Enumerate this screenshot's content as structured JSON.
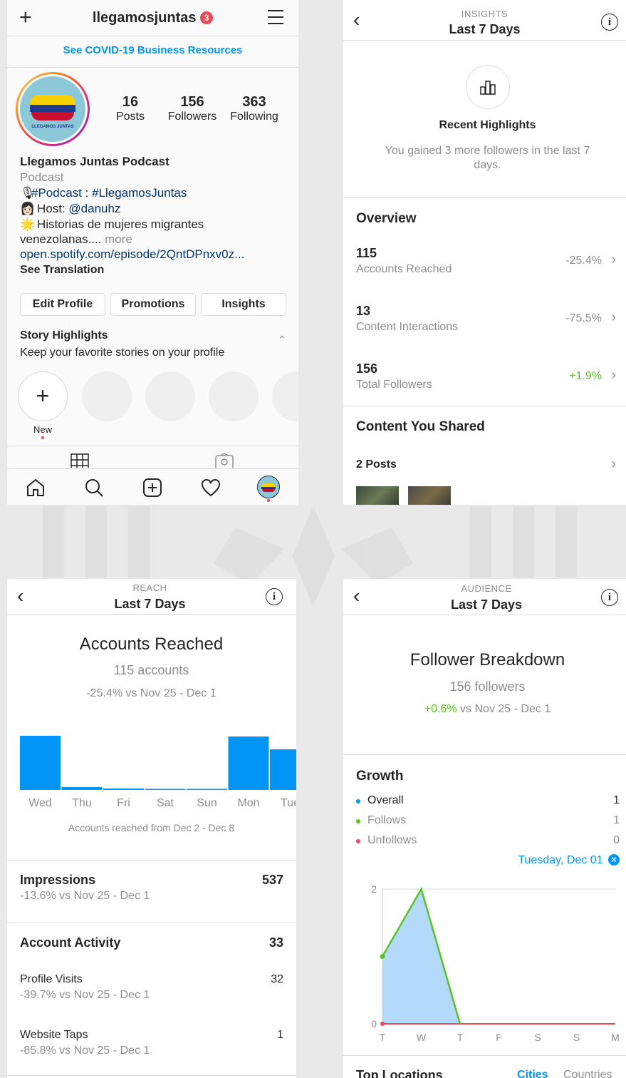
{
  "profile": {
    "username": "llegamosjuntas",
    "notif_count": "3",
    "covid_link": "See COVID-19 Business Resources",
    "avatar_text": "LLEGAMOS JUNTAS",
    "stats": [
      {
        "value": "16",
        "label": "Posts"
      },
      {
        "value": "156",
        "label": "Followers"
      },
      {
        "value": "363",
        "label": "Following"
      }
    ],
    "name": "Llegamos Juntas Podcast",
    "category": "Podcast",
    "bio_line1_tag1": "#Podcast",
    "bio_line1_sep": " : ",
    "bio_line1_tag2": "#LlegamosJuntas",
    "bio_line2_prefix": "Host: ",
    "bio_line2_handle": "@danuhz",
    "bio_line3": "Historias de mujeres migrantes",
    "bio_line4": "venezolanas....",
    "bio_more": " more",
    "bio_url": "open.spotify.com/episode/2QntDPnxv0z...",
    "see_translation": "See Translation",
    "buttons": {
      "edit": "Edit Profile",
      "promotions": "Promotions",
      "insights": "Insights"
    },
    "highlights_title": "Story Highlights",
    "highlights_subtitle": "Keep your favorite stories on your profile",
    "new_label": "New"
  },
  "insights": {
    "header_small": "INSIGHTS",
    "header_title": "Last 7 Days",
    "recent_title": "Recent Highlights",
    "recent_text": "You gained 3 more followers in the last 7 days.",
    "overview_title": "Overview",
    "overview": [
      {
        "value": "115",
        "label": "Accounts Reached",
        "change": "-25.4%",
        "positive": false
      },
      {
        "value": "13",
        "label": "Content Interactions",
        "change": "-75.5%",
        "positive": false
      },
      {
        "value": "156",
        "label": "Total Followers",
        "change": "+1.9%",
        "positive": true
      }
    ],
    "content_title": "Content You Shared",
    "posts_label": "2 Posts"
  },
  "reach": {
    "header_small": "REACH",
    "header_title": "Last 7 Days",
    "title": "Accounts Reached",
    "accounts": "115 accounts",
    "compare": "-25.4% vs Nov 25 - Dec 1",
    "chart_caption": "Accounts reached from Dec 2 - Dec 8",
    "impressions_label": "Impressions",
    "impressions_value": "537",
    "impressions_compare": "-13.6% vs Nov 25 - Dec 1",
    "activity_label": "Account Activity",
    "activity_value": "33",
    "profile_visits_label": "Profile Visits",
    "profile_visits_value": "32",
    "profile_visits_compare": "-39.7% vs Nov 25 - Dec 1",
    "website_taps_label": "Website Taps",
    "website_taps_value": "1",
    "website_taps_compare": "-85.8% vs Nov 25 - Dec 1"
  },
  "audience": {
    "header_small": "AUDIENCE",
    "header_title": "Last 7 Days",
    "title": "Follower Breakdown",
    "followers": "156 followers",
    "change": "+0.6%",
    "compare": " vs Nov 25 - Dec 1",
    "growth_title": "Growth",
    "growth": [
      {
        "label": "Overall",
        "value": "1",
        "color": "#0095f6"
      },
      {
        "label": "Follows",
        "value": "1",
        "color": "#58c322"
      },
      {
        "label": "Unfollows",
        "value": "0",
        "color": "#ed4956"
      }
    ],
    "selected_day": "Tuesday, Dec 01",
    "top_locations": "Top Locations",
    "tab_cities": "Cities",
    "tab_countries": "Countries"
  },
  "chart_data": [
    {
      "type": "bar",
      "categories": [
        "Wed",
        "Thu",
        "Fri",
        "Sat",
        "Sun",
        "Mon",
        "Tue"
      ],
      "values": [
        76,
        4,
        2,
        1,
        1,
        75,
        57
      ],
      "ylim": [
        0,
        80
      ],
      "color": "#0095f6"
    },
    {
      "type": "area",
      "categories": [
        "T",
        "W",
        "T",
        "F",
        "S",
        "S",
        "M"
      ],
      "series": [
        {
          "values": [
            1,
            2,
            0,
            0,
            0,
            0,
            0
          ],
          "color": "#58c322"
        },
        {
          "values": [
            0,
            0,
            0,
            0,
            0,
            0,
            0
          ],
          "color": "#ed4956"
        }
      ],
      "yticks": [
        "0",
        "2"
      ],
      "ylim": [
        0,
        2
      ]
    }
  ]
}
